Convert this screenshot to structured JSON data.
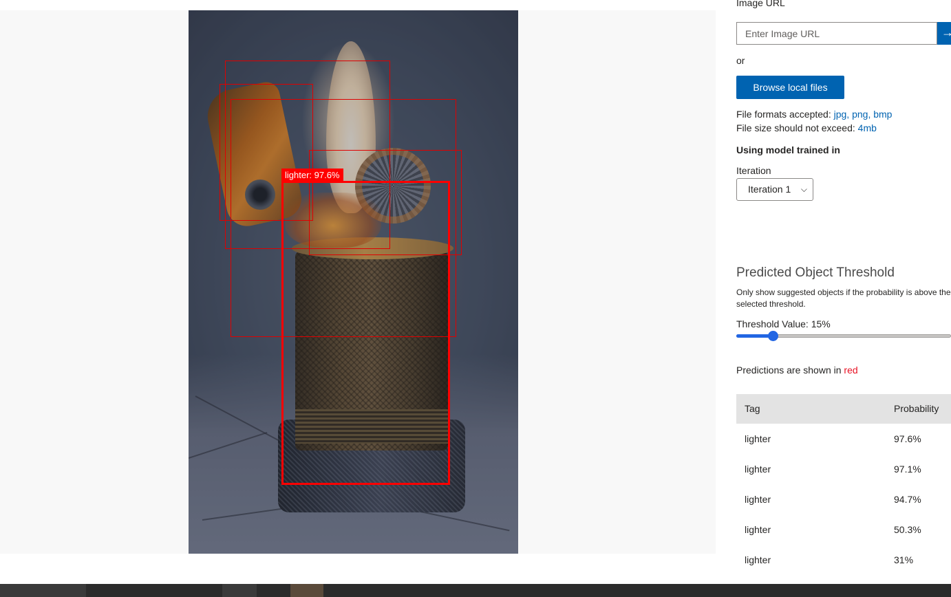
{
  "image_url": {
    "label": "Image URL",
    "placeholder": "Enter Image URL",
    "go_icon": "arrow-right-icon",
    "go_glyph": "→"
  },
  "or_text": "or",
  "browse_button": "Browse local files",
  "formats": {
    "label": "File formats accepted:",
    "values": "jpg, png, bmp"
  },
  "size": {
    "label": "File size should not exceed:",
    "value": "4mb"
  },
  "model_heading": "Using model trained in",
  "iteration": {
    "label": "Iteration",
    "selected": "Iteration 1"
  },
  "threshold": {
    "title": "Predicted Object Threshold",
    "description_line1": "Only show suggested objects if the probability is above the",
    "description_line2": "selected threshold.",
    "value_text": "Threshold Value: 15%",
    "value_fraction": 0.15
  },
  "predictions_note": {
    "prefix": "Predictions are shown in",
    "color_word": "red"
  },
  "table": {
    "headers": [
      "Tag",
      "Probability"
    ],
    "rows": [
      {
        "tag": "lighter",
        "probability": "97.6%"
      },
      {
        "tag": "lighter",
        "probability": "97.1%"
      },
      {
        "tag": "lighter",
        "probability": "94.7%"
      },
      {
        "tag": "lighter",
        "probability": "50.3%"
      },
      {
        "tag": "lighter",
        "probability": "31%"
      }
    ]
  },
  "detection_label": "lighter: 97.6%",
  "colors": {
    "accent": "#0063b1",
    "prediction": "#ff0000",
    "slider": "#2266e3"
  }
}
